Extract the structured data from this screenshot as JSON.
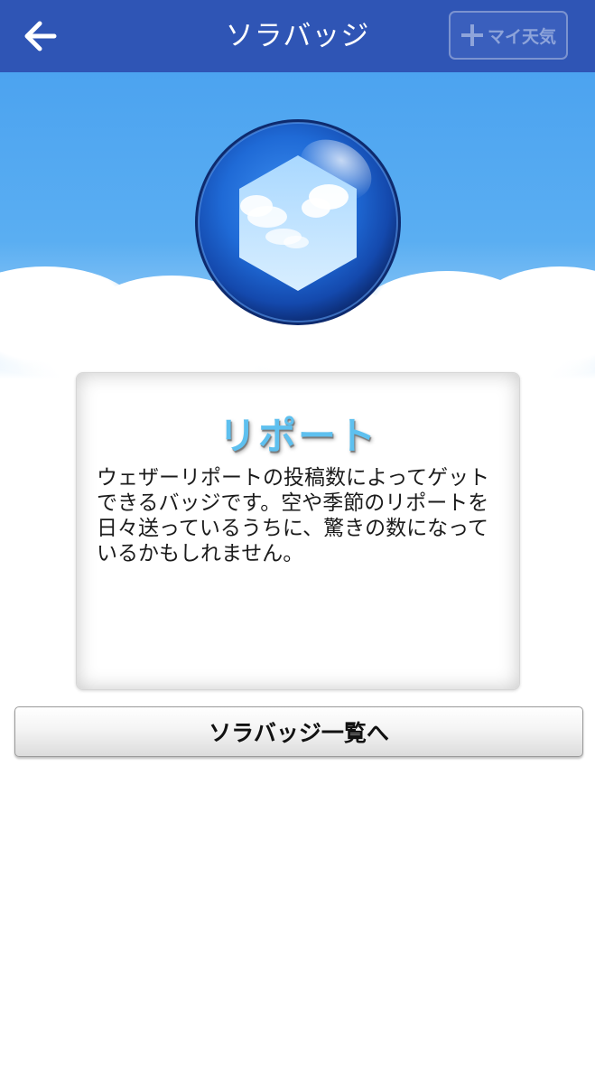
{
  "header": {
    "title": "ソラバッジ",
    "back_icon": "arrow-left-icon",
    "mytenki_button": {
      "label": "マイ天気",
      "icon": "plus-icon"
    }
  },
  "badge": {
    "icon": "hexagon-cloud-badge-icon"
  },
  "card": {
    "title": "リポート",
    "description": "ウェザーリポートの投稿数によってゲットできるバッジです。空や季節のリポートを日々送っているうちに、驚きの数になっているかもしれません。"
  },
  "footer_button": {
    "label": "ソラバッジ一覧へ"
  },
  "colors": {
    "navbar": "#2f55b5",
    "sky": "#4ca3f0",
    "card_title": "#5ec0ef"
  }
}
